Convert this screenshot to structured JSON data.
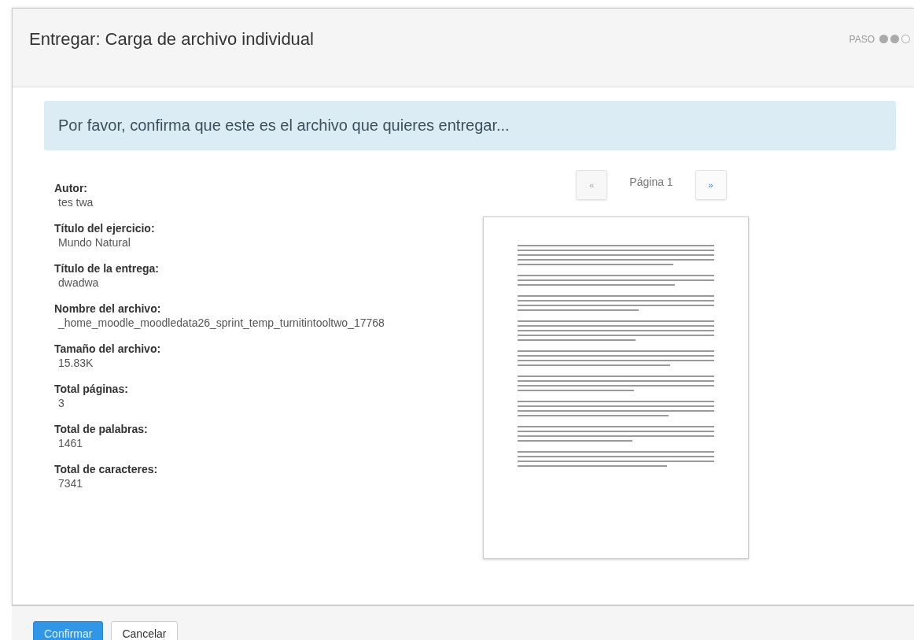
{
  "dialog": {
    "title": "Entregar: Carga de archivo individual",
    "step_label": "PASO",
    "steps": [
      {
        "done": true
      },
      {
        "done": true
      },
      {
        "done": false
      }
    ]
  },
  "alert": "Por favor, confirma que este es el archivo que quieres entregar...",
  "fields": [
    {
      "label": "Autor:",
      "value": "tes twa"
    },
    {
      "label": "Título del ejercicio:",
      "value": "Mundo Natural"
    },
    {
      "label": "Título de la entrega:",
      "value": "dwadwa"
    },
    {
      "label": "Nombre del archivo:",
      "value": "_home_moodle_moodledata26_sprint_temp_turnitintooltwo_17768"
    },
    {
      "label": "Tamaño del archivo:",
      "value": "15.83K"
    },
    {
      "label": "Total páginas:",
      "value": "3"
    },
    {
      "label": "Total de palabras:",
      "value": "1461"
    },
    {
      "label": "Total de caracteres:",
      "value": "7341"
    }
  ],
  "pager": {
    "prev": {
      "label": "«",
      "disabled": true
    },
    "page": "Página 1",
    "next": {
      "label": "»",
      "disabled": false
    }
  },
  "preview": {
    "kind": "document"
  },
  "buttons": [
    {
      "label": "Confirmar",
      "kind": "primary"
    },
    {
      "label": "Cancelar",
      "kind": "default"
    }
  ]
}
